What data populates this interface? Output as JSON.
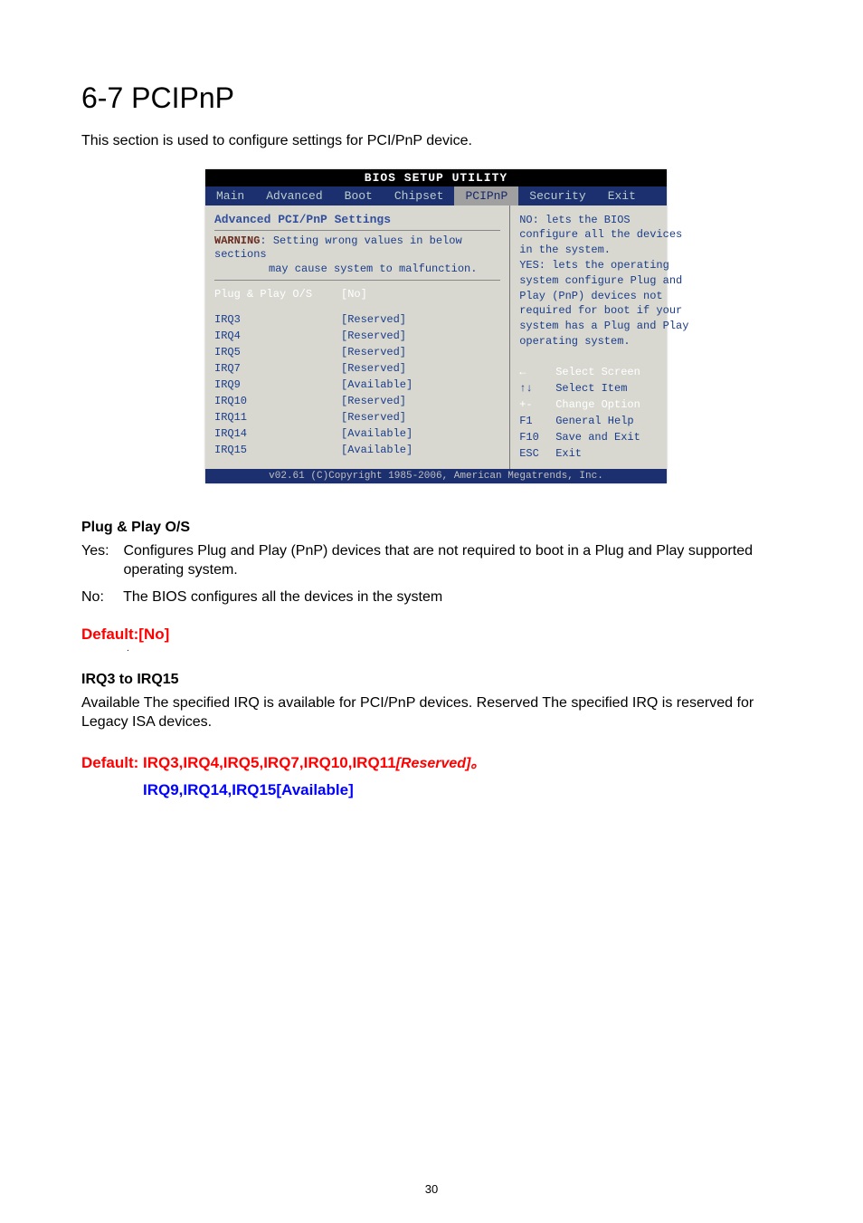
{
  "page": {
    "title": "6-7 PCIPnP",
    "intro": "This section is used to configure settings for PCI/PnP device.",
    "number": "30"
  },
  "bios": {
    "window_title": "BIOS SETUP UTILITY",
    "tabs": [
      "Main",
      "Advanced",
      "Boot",
      "Chipset",
      "PCIPnP",
      "Security",
      "Exit"
    ],
    "left": {
      "heading": "Advanced PCI/PnP Settings",
      "warning_prefix": "WARNING",
      "warning1": ": Setting wrong values in below sections",
      "warning2": "may cause system to malfunction.",
      "pnp_label": "Plug & Play O/S",
      "pnp_value": "[No]",
      "rows": [
        {
          "label": "IRQ3",
          "value": "[Reserved]"
        },
        {
          "label": "IRQ4",
          "value": "[Reserved]"
        },
        {
          "label": "IRQ5",
          "value": "[Reserved]"
        },
        {
          "label": "IRQ7",
          "value": "[Reserved]"
        },
        {
          "label": "IRQ9",
          "value": "[Available]"
        },
        {
          "label": "IRQ10",
          "value": "[Reserved]"
        },
        {
          "label": "IRQ11",
          "value": "[Reserved]"
        },
        {
          "label": "IRQ14",
          "value": "[Available]"
        },
        {
          "label": "IRQ15",
          "value": "[Available]"
        }
      ]
    },
    "right": {
      "help1": "NO: lets the BIOS configure all the devices in the system.",
      "help2": "YES: lets the operating system configure Plug and Play (PnP) devices not required for boot if your system has a Plug and Play operating system.",
      "keys": [
        {
          "k": "←",
          "desc": "Select Screen"
        },
        {
          "k": "↑↓",
          "desc": "Select Item"
        },
        {
          "k": "+-",
          "desc": "Change Option"
        },
        {
          "k": "F1",
          "desc": "General Help"
        },
        {
          "k": "F10",
          "desc": "Save and Exit"
        },
        {
          "k": "ESC",
          "desc": "Exit"
        }
      ]
    },
    "footer": "v02.61 (C)Copyright 1985-2006, American Megatrends, Inc."
  },
  "plug_play": {
    "title": "Plug & Play O/S",
    "yes_label": "Yes:",
    "yes_text": "Configures Plug and Play (PnP) devices that are not required to boot in a Plug and Play supported operating system.",
    "no_label": "No:",
    "no_text": "The BIOS configures all the devices in the system",
    "default": "Default:[No]"
  },
  "irq_section": {
    "title": "IRQ3 to IRQ15",
    "desc": "Available The specified IRQ is available for PCI/PnP devices. Reserved The specified IRQ is reserved for Legacy ISA devices.",
    "default_label": "Default: IRQ3,IRQ4,IRQ5,IRQ7,IRQ10,IRQ11",
    "default_reserved": "[Reserved]。",
    "default_avail": "IRQ9,IRQ14,IRQ15[Available]"
  }
}
